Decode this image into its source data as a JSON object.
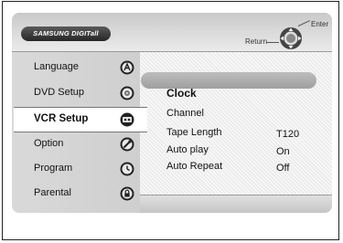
{
  "brand": {
    "logo_text": "SAMSUNG DIGITall"
  },
  "controls": {
    "return_label": "Return",
    "enter_label": "Enter"
  },
  "sidebar": {
    "items": [
      {
        "label": "Language",
        "icon": "language-icon",
        "selected": false
      },
      {
        "label": "DVD Setup",
        "icon": "disc-icon",
        "selected": false
      },
      {
        "label": "VCR Setup",
        "icon": "tape-icon",
        "selected": true
      },
      {
        "label": "Option",
        "icon": "option-icon",
        "selected": false
      },
      {
        "label": "Program",
        "icon": "program-icon",
        "selected": false
      },
      {
        "label": "Parental",
        "icon": "lock-icon",
        "selected": false
      }
    ]
  },
  "submenu": {
    "items": [
      {
        "label": "Clock",
        "value": "",
        "selected": true
      },
      {
        "label": "Channel",
        "value": ""
      },
      {
        "label": "Tape Length",
        "value": "T120"
      },
      {
        "label": "Auto play",
        "value": "On"
      },
      {
        "label": "Auto Repeat",
        "value": "Off"
      }
    ]
  }
}
